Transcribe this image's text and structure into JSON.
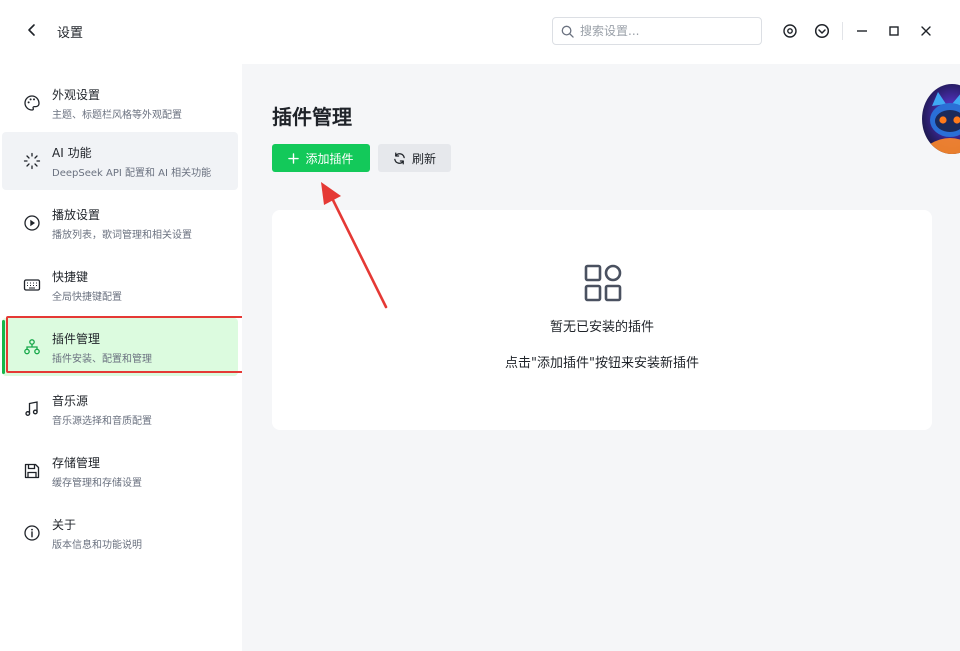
{
  "window": {
    "title": "设置",
    "search_placeholder": "搜索设置..."
  },
  "sidebar": {
    "items": [
      {
        "label": "外观设置",
        "desc": "主题、标题栏风格等外观配置",
        "icon": "palette-icon"
      },
      {
        "label": "AI 功能",
        "desc": "DeepSeek API 配置和 AI 相关功能",
        "icon": "ai-sparkle-icon"
      },
      {
        "label": "播放设置",
        "desc": "播放列表，歌词管理和相关设置",
        "icon": "play-circle-icon"
      },
      {
        "label": "快捷键",
        "desc": "全局快捷键配置",
        "icon": "keyboard-icon"
      },
      {
        "label": "插件管理",
        "desc": "插件安装、配置和管理",
        "icon": "plugin-nodes-icon"
      },
      {
        "label": "音乐源",
        "desc": "音乐源选择和音质配置",
        "icon": "music-note-icon"
      },
      {
        "label": "存储管理",
        "desc": "缓存管理和存储设置",
        "icon": "floppy-disk-icon"
      },
      {
        "label": "关于",
        "desc": "版本信息和功能说明",
        "icon": "info-circle-icon"
      }
    ]
  },
  "main": {
    "title": "插件管理",
    "add_button": "添加插件",
    "refresh_button": "刷新",
    "empty_title": "暂无已安装的插件",
    "empty_hint": "点击\"添加插件\"按钮来安装新插件"
  },
  "colors": {
    "accent": "#13c95a",
    "active_bg": "#dcfbdf",
    "annotation": "#e53935"
  }
}
